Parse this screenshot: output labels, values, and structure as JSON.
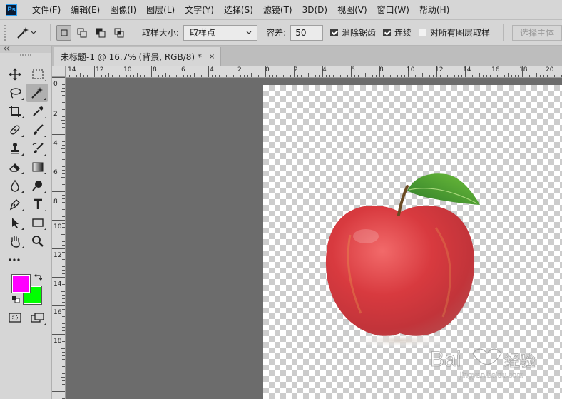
{
  "app": {
    "logo_text": "Ps"
  },
  "menu": [
    "文件(F)",
    "编辑(E)",
    "图像(I)",
    "图层(L)",
    "文字(Y)",
    "选择(S)",
    "滤镜(T)",
    "3D(D)",
    "视图(V)",
    "窗口(W)",
    "帮助(H)"
  ],
  "options": {
    "sample_size_label": "取样大小:",
    "sample_size_value": "取样点",
    "tolerance_label": "容差:",
    "tolerance_value": "50",
    "antialias_label": "消除锯齿",
    "antialias_checked": true,
    "contiguous_label": "连续",
    "contiguous_checked": true,
    "sample_all_label": "对所有图层取样",
    "sample_all_checked": false,
    "select_subject_label": "选择主体"
  },
  "document": {
    "tab_title": "未标题-1 @ 16.7% (背景, RGB/8) *",
    "close_glyph": "×"
  },
  "ruler_h_labels": [
    "14",
    "12",
    "10",
    "8",
    "6",
    "4",
    "2",
    "0",
    "2",
    "4",
    "6",
    "8",
    "10",
    "12",
    "14",
    "16",
    "18",
    "20"
  ],
  "ruler_v_labels": [
    "0",
    "2",
    "4",
    "6",
    "8",
    "10",
    "12",
    "14",
    "16",
    "18"
  ],
  "colors": {
    "foreground": "#ff00ff",
    "background": "#00ff00",
    "accent": "#2fa3f7"
  },
  "tools": [
    {
      "name": "move-tool-icon",
      "glyph": "✥"
    },
    {
      "name": "marquee-tool-icon",
      "glyph": "⬚"
    },
    {
      "name": "lasso-tool-icon",
      "glyph": "➰"
    },
    {
      "name": "magic-wand-tool-icon",
      "glyph": "✧"
    },
    {
      "name": "crop-tool-icon",
      "glyph": "⌗"
    },
    {
      "name": "eyedropper-tool-icon",
      "glyph": "✎"
    },
    {
      "name": "healing-brush-tool-icon",
      "glyph": "✚"
    },
    {
      "name": "brush-tool-icon",
      "glyph": "✐"
    },
    {
      "name": "clone-stamp-tool-icon",
      "glyph": "♟"
    },
    {
      "name": "history-brush-tool-icon",
      "glyph": "✍"
    },
    {
      "name": "eraser-tool-icon",
      "glyph": "◪"
    },
    {
      "name": "gradient-tool-icon",
      "glyph": "▤"
    },
    {
      "name": "blur-tool-icon",
      "glyph": "💧"
    },
    {
      "name": "dodge-tool-icon",
      "glyph": "●"
    },
    {
      "name": "pen-tool-icon",
      "glyph": "✒"
    },
    {
      "name": "type-tool-icon",
      "glyph": "T"
    },
    {
      "name": "path-selection-tool-icon",
      "glyph": "➤"
    },
    {
      "name": "rectangle-tool-icon",
      "glyph": "▭"
    },
    {
      "name": "hand-tool-icon",
      "glyph": "✋"
    },
    {
      "name": "zoom-tool-icon",
      "glyph": "🔍"
    },
    {
      "name": "more-tools-icon",
      "glyph": "•••"
    }
  ]
}
